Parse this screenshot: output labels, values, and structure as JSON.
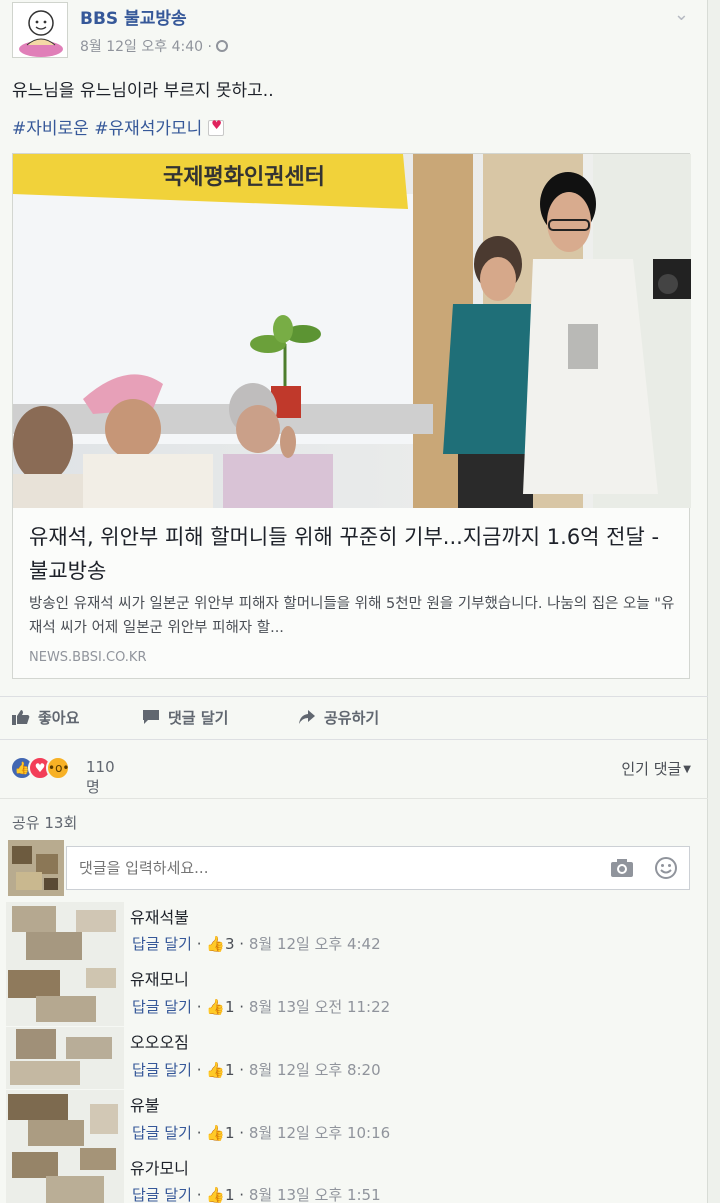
{
  "post": {
    "page_name": "BBS 불교방송",
    "time": "8월 12일 오후 4:40 ·",
    "text": "유느님을 유느님이라 부르지 못하고..",
    "hashtags": "#자비로운 #유재석가모니"
  },
  "link": {
    "photo_banner": "국제평화인권센터",
    "title": "유재석, 위안부 피해 할머니들 위해 꾸준히 기부...지금까지 1.6억 전달 - 불교방송",
    "desc": "방송인 유재석 씨가 일본군 위안부 피해자 할머니들을 위해 5천만 원을 기부했습니다. 나눔의 집은 오늘 \"유재석 씨가 어제 일본군 위안부 피해자 할...",
    "domain": "NEWS.BBSI.CO.KR"
  },
  "actions": {
    "like": "좋아요",
    "comment": "댓글 달기",
    "share": "공유하기"
  },
  "reactions": {
    "count": "110명",
    "sort_label": "인기 댓글"
  },
  "shares": "공유 13회",
  "composer": {
    "placeholder": "댓글을 입력하세요..."
  },
  "comments": [
    {
      "name": "유재석불",
      "reply": "답글 달기",
      "likes": "3",
      "time": "8월 12일 오후 4:42"
    },
    {
      "name": "유재모니",
      "reply": "답글 달기",
      "likes": "1",
      "time": "8월 13일 오전 11:22"
    },
    {
      "name": "오오오짐",
      "reply": "답글 달기",
      "likes": "1",
      "time": "8월 12일 오후 8:20"
    },
    {
      "name": "유불",
      "reply": "답글 달기",
      "likes": "1",
      "time": "8월 12일 오후 10:16"
    },
    {
      "name": "유가모니",
      "reply": "답글 달기",
      "likes": "1",
      "time": "8월 13일 오후 1:51"
    }
  ],
  "colors": {
    "link_blue": "#365899",
    "like_blue": "#4267b2",
    "love_red": "#f33e58",
    "wow_yellow": "#f7b125",
    "muted": "#90949c"
  }
}
